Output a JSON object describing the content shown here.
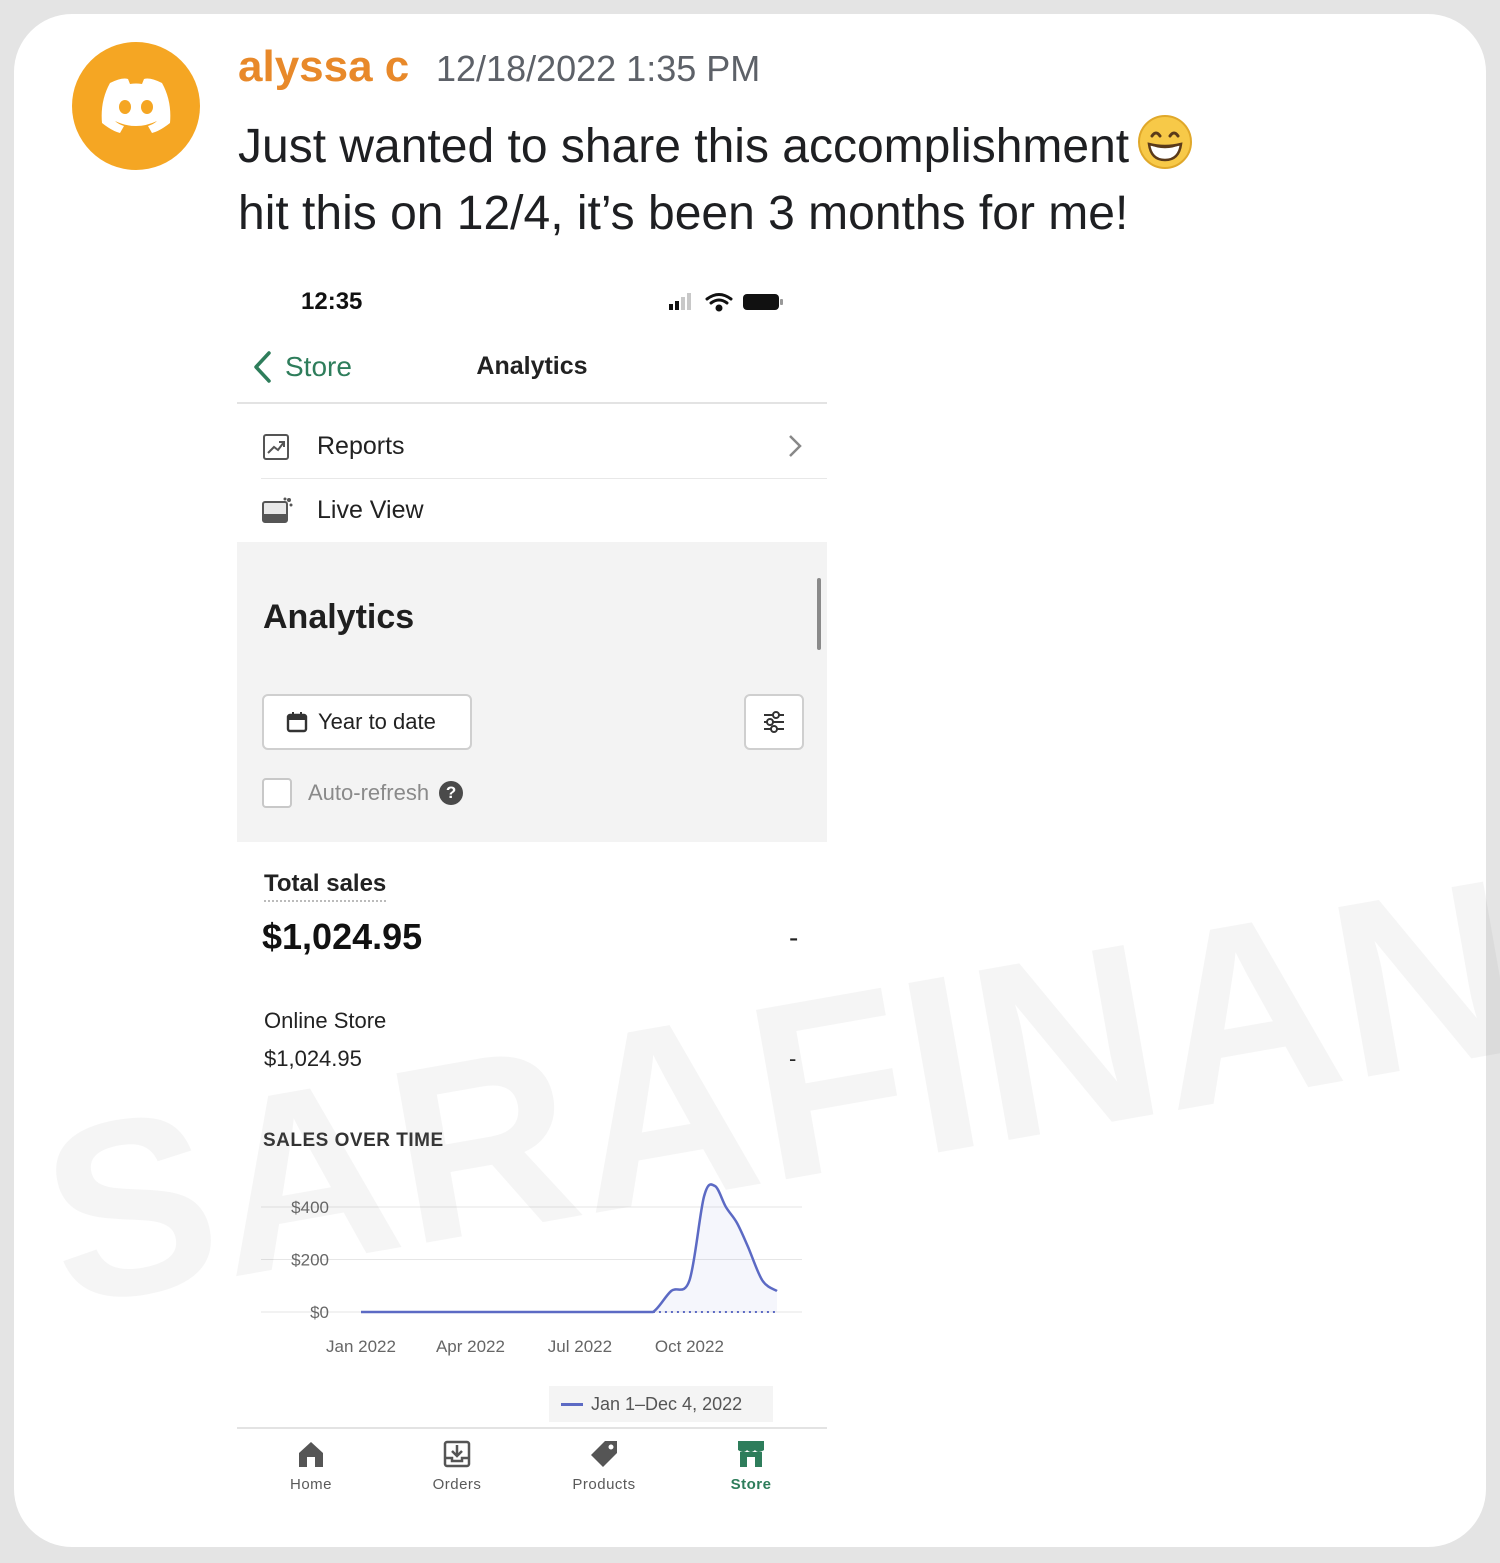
{
  "message": {
    "username": "alyssa c",
    "timestamp": "12/18/2022 1:35 PM",
    "line1": "Just wanted to share this accomplishment",
    "line2": "hit this on 12/4, it’s been 3 months for me!",
    "emoji": "grinning-face-with-smiling-eyes"
  },
  "phone": {
    "status_time": "12:35",
    "nav": {
      "back_label": "Store",
      "title": "Analytics"
    },
    "menu": [
      {
        "label": "Reports",
        "icon": "reports-icon"
      },
      {
        "label": "Live View",
        "icon": "live-view-icon"
      }
    ],
    "analytics": {
      "heading": "Analytics",
      "date_range": "Year to date",
      "auto_refresh": "Auto-refresh",
      "auto_refresh_checked": false,
      "help": "?"
    },
    "total_sales": {
      "label": "Total sales",
      "value": "$1,024.95",
      "change": "-"
    },
    "online_store": {
      "label": "Online Store",
      "value": "$1,024.95",
      "change": "-"
    },
    "sales_over_time": "SALES OVER TIME",
    "legend": "Jan 1–Dec 4, 2022",
    "tabs": [
      {
        "label": "Home",
        "icon": "home-icon",
        "active": false
      },
      {
        "label": "Orders",
        "icon": "orders-icon",
        "active": false
      },
      {
        "label": "Products",
        "icon": "tag-icon",
        "active": false
      },
      {
        "label": "Store",
        "icon": "store-icon",
        "active": true
      }
    ]
  },
  "colors": {
    "username": "#e8892a",
    "accent": "#2e7d5b",
    "series": "#5c6ac4",
    "avatar": "#f5a623"
  },
  "watermark": "SARAFINANCE",
  "chart_data": {
    "type": "line",
    "title": "SALES OVER TIME",
    "x_tick_labels": [
      "Jan 2022",
      "Apr 2022",
      "Jul 2022",
      "Oct 2022"
    ],
    "y_tick_labels": [
      "$400",
      "$200",
      "$0"
    ],
    "ylim": [
      0,
      480
    ],
    "grid": true,
    "legend": "bottom-right",
    "series": [
      {
        "name": "Jan 1–Dec 4, 2022",
        "x": [
          0,
          1,
          2,
          3,
          4,
          5,
          6,
          7,
          7.5,
          8,
          8.5,
          9,
          9.4,
          9.7,
          10,
          10.3,
          10.6,
          11,
          11.4
        ],
        "values": [
          0,
          0,
          0,
          0,
          0,
          0,
          0,
          0,
          0,
          0,
          80,
          120,
          440,
          480,
          400,
          340,
          250,
          120,
          80
        ]
      }
    ]
  }
}
